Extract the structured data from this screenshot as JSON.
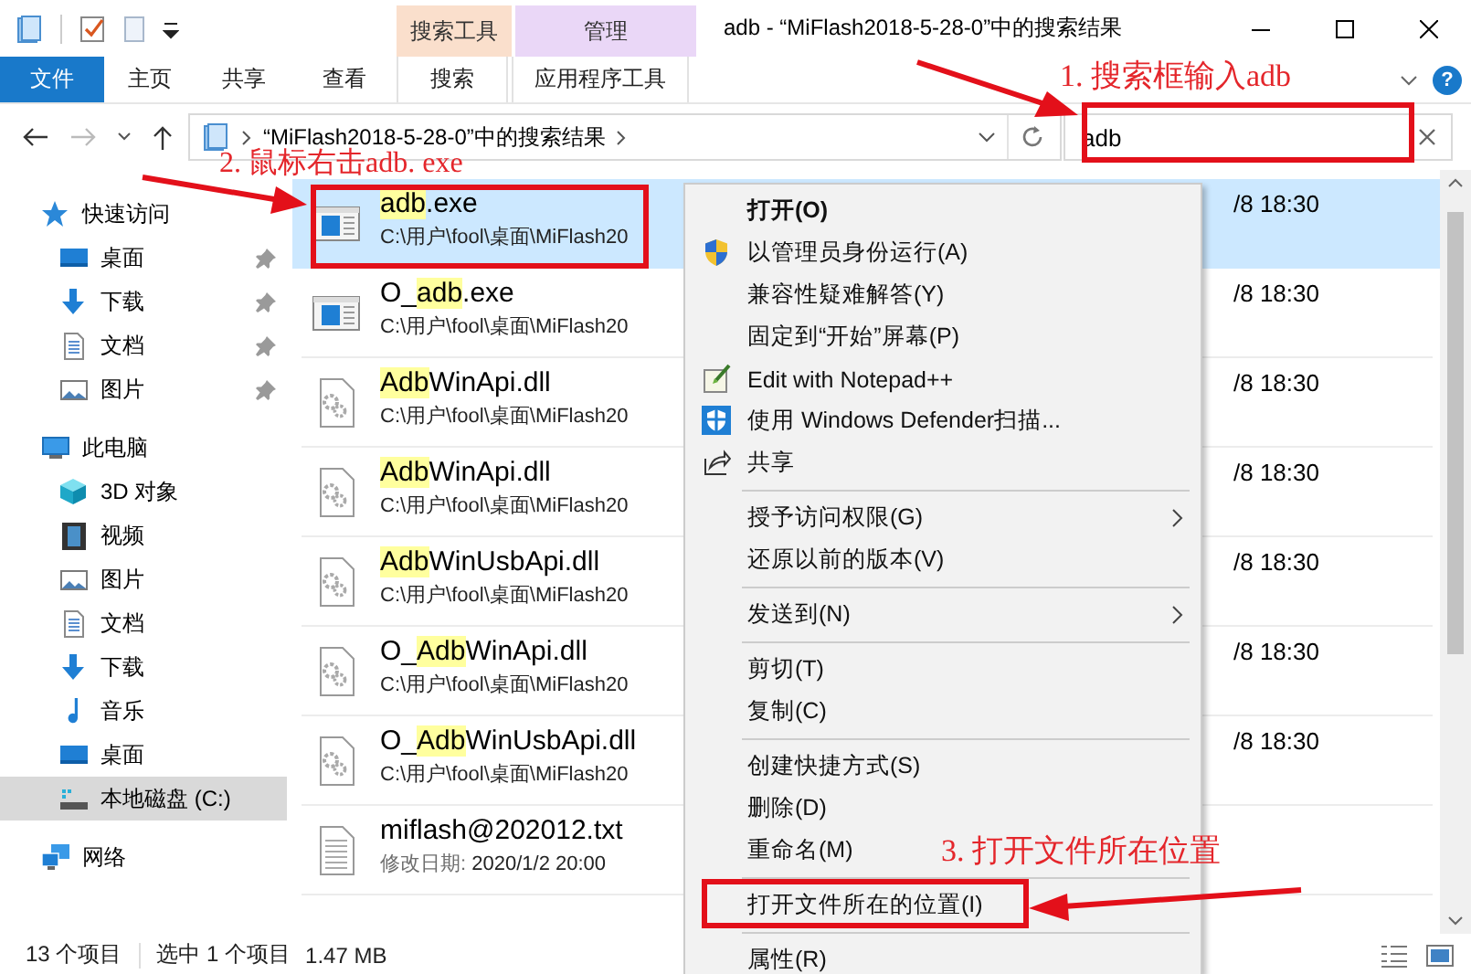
{
  "window": {
    "title": "adb - “MiFlash2018-5-28-0”中的搜索结果",
    "context_tabs": [
      {
        "label": "搜索工具",
        "color": "#fadfcc"
      },
      {
        "label": "管理",
        "color": "#ead7f7"
      }
    ]
  },
  "ribbon": {
    "tabs": [
      {
        "label": "文件",
        "kind": "file"
      },
      {
        "label": "主页",
        "kind": "tab"
      },
      {
        "label": "共享",
        "kind": "tab"
      },
      {
        "label": "查看",
        "kind": "tab"
      },
      {
        "label": "搜索",
        "kind": "context"
      },
      {
        "label": "应用程序工具",
        "kind": "context"
      }
    ],
    "help": "?"
  },
  "address_bar": {
    "path": "“MiFlash2018-5-28-0”中的搜索结果"
  },
  "search": {
    "value": "adb"
  },
  "sidebar": {
    "items": [
      {
        "label": "快速访问",
        "kind": "star",
        "selected": false,
        "children": [
          {
            "label": "桌面",
            "kind": "desktop",
            "selected": false,
            "pinned": true
          },
          {
            "label": "下载",
            "kind": "download",
            "selected": false,
            "pinned": true
          },
          {
            "label": "文档",
            "kind": "document",
            "selected": false,
            "pinned": true
          },
          {
            "label": "图片",
            "kind": "picture",
            "selected": false,
            "pinned": true
          }
        ]
      },
      {
        "label": "此电脑",
        "kind": "computer",
        "selected": false,
        "children": [
          {
            "label": "3D 对象",
            "kind": "cube",
            "selected": false
          },
          {
            "label": "视频",
            "kind": "video",
            "selected": false
          },
          {
            "label": "图片",
            "kind": "picture",
            "selected": false
          },
          {
            "label": "文档",
            "kind": "document",
            "selected": false
          },
          {
            "label": "下载",
            "kind": "download",
            "selected": false
          },
          {
            "label": "音乐",
            "kind": "music",
            "selected": false
          },
          {
            "label": "桌面",
            "kind": "desktop",
            "selected": false
          },
          {
            "label": "本地磁盘 (C:)",
            "kind": "drive",
            "selected": true
          }
        ]
      },
      {
        "label": "网络",
        "kind": "network",
        "selected": false
      }
    ]
  },
  "files": [
    {
      "kind": "exe",
      "selected": true,
      "match": "adb",
      "after": ".exe",
      "detail": "C:\\用户\\fool\\桌面\\MiFlash20",
      "date": "/8 18:30"
    },
    {
      "kind": "exe",
      "selected": false,
      "before": "O_",
      "match": "adb",
      "after": ".exe",
      "detail": "C:\\用户\\fool\\桌面\\MiFlash20",
      "date": "/8 18:30"
    },
    {
      "kind": "dll",
      "selected": false,
      "match": "Adb",
      "after": "WinApi.dll",
      "detail": "C:\\用户\\fool\\桌面\\MiFlash20",
      "date": "/8 18:30"
    },
    {
      "kind": "dll",
      "selected": false,
      "match": "Adb",
      "after": "WinApi.dll",
      "detail": "C:\\用户\\fool\\桌面\\MiFlash20",
      "date": "/8 18:30"
    },
    {
      "kind": "dll",
      "selected": false,
      "match": "Adb",
      "after": "WinUsbApi.dll",
      "detail": "C:\\用户\\fool\\桌面\\MiFlash20",
      "date": "/8 18:30"
    },
    {
      "kind": "dll",
      "selected": false,
      "before": "O_",
      "match": "Adb",
      "after": "WinApi.dll",
      "detail": "C:\\用户\\fool\\桌面\\MiFlash20",
      "date": "/8 18:30"
    },
    {
      "kind": "dll",
      "selected": false,
      "before": "O_",
      "match": "Adb",
      "after": "WinUsbApi.dll",
      "detail": "C:\\用户\\fool\\桌面\\MiFlash20",
      "date": "/8 18:30"
    },
    {
      "kind": "txt",
      "selected": false,
      "before": "miflash@202012.txt",
      "detail_label": "修改日期:",
      "detail": "2020/1/2 20:00"
    }
  ],
  "context_menu": {
    "items": [
      {
        "kind": "plain",
        "label": "打开(O)",
        "default": true,
        "submenu": false
      },
      {
        "kind": "admin",
        "label": "以管理员身份运行(A)",
        "default": false,
        "submenu": false
      },
      {
        "kind": "plain",
        "label": "兼容性疑难解答(Y)",
        "default": false,
        "submenu": false
      },
      {
        "kind": "plain",
        "label": "固定到“开始”屏幕(P)",
        "default": false,
        "submenu": false
      },
      {
        "kind": "notepad",
        "label": "Edit with Notepad++",
        "default": false,
        "submenu": false
      },
      {
        "kind": "defender",
        "label": "使用 Windows Defender扫描...",
        "default": false,
        "submenu": false
      },
      {
        "kind": "share",
        "label": "共享",
        "default": false,
        "submenu": false
      },
      {
        "kind": "separator"
      },
      {
        "kind": "plain",
        "label": "授予访问权限(G)",
        "default": false,
        "submenu": true
      },
      {
        "kind": "plain",
        "label": "还原以前的版本(V)",
        "default": false,
        "submenu": false
      },
      {
        "kind": "separator"
      },
      {
        "kind": "plain",
        "label": "发送到(N)",
        "default": false,
        "submenu": true
      },
      {
        "kind": "separator"
      },
      {
        "kind": "plain",
        "label": "剪切(T)",
        "default": false,
        "submenu": false
      },
      {
        "kind": "plain",
        "label": "复制(C)",
        "default": false,
        "submenu": false
      },
      {
        "kind": "separator"
      },
      {
        "kind": "plain",
        "label": "创建快捷方式(S)",
        "default": false,
        "submenu": false
      },
      {
        "kind": "plain",
        "label": "删除(D)",
        "default": false,
        "submenu": false
      },
      {
        "kind": "plain",
        "label": "重命名(M)",
        "default": false,
        "submenu": false
      },
      {
        "kind": "separator"
      },
      {
        "kind": "plain",
        "label": "打开文件所在的位置(I)",
        "default": false,
        "submenu": false
      },
      {
        "kind": "separator"
      },
      {
        "kind": "plain",
        "label": "属性(R)",
        "default": false,
        "submenu": false
      }
    ]
  },
  "status_bar": {
    "item_count": "13 个项目",
    "selection": "选中 1 个项目",
    "size": "1.47 MB"
  },
  "annotations": [
    {
      "text": "1. 搜索框输入adb"
    },
    {
      "text": "2. 鼠标右击adb. exe"
    },
    {
      "text": "3. 打开文件所在位置"
    }
  ]
}
